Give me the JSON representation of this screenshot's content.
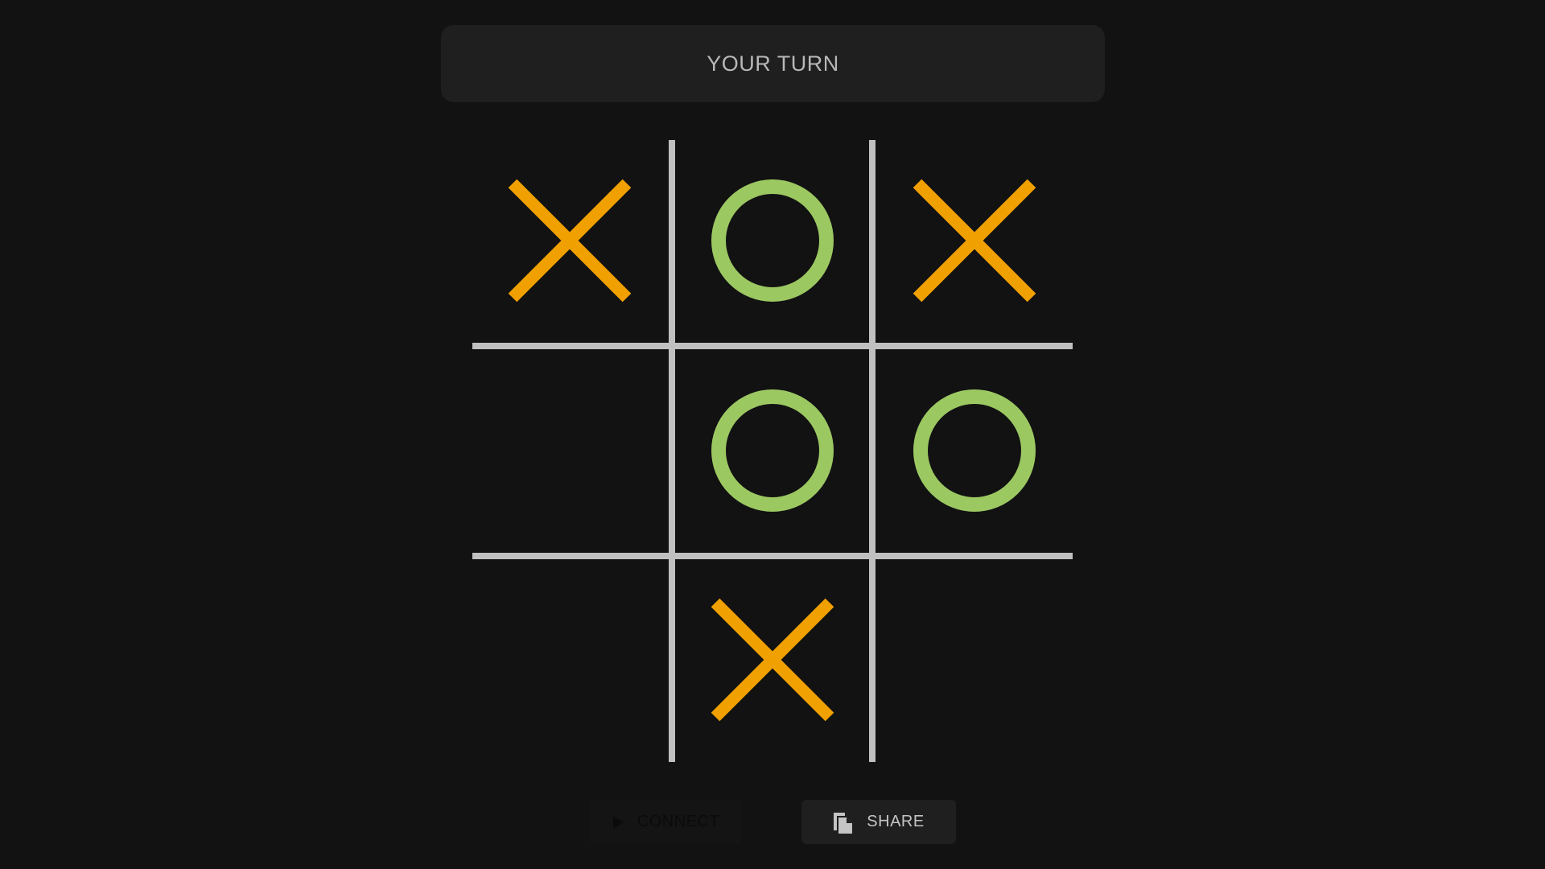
{
  "status": {
    "text": "YOUR TURN"
  },
  "board": {
    "cells": [
      "X",
      "O",
      "X",
      "",
      "O",
      "O",
      "",
      "X",
      ""
    ],
    "colors": {
      "x": "#f0a000",
      "o": "#9cc862",
      "grid": "#c0c0c0"
    }
  },
  "buttons": {
    "connect": {
      "label": "CONNECT",
      "icon": "play-icon",
      "disabled": true
    },
    "share": {
      "label": "SHARE",
      "icon": "copy-icon"
    }
  }
}
